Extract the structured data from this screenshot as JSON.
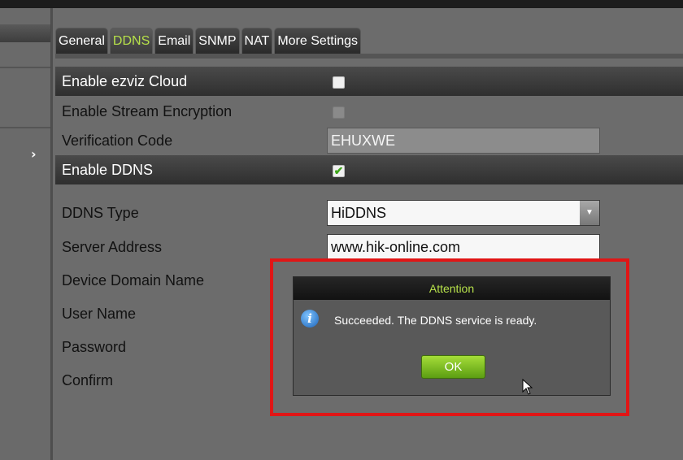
{
  "left_nav": {
    "expand_glyph": "›"
  },
  "tabs": [
    {
      "label": "General"
    },
    {
      "label": "DDNS"
    },
    {
      "label": "Email"
    },
    {
      "label": "SNMP"
    },
    {
      "label": "NAT"
    },
    {
      "label": "More Settings"
    }
  ],
  "active_tab": "DDNS",
  "form": {
    "ezviz_label": "Enable ezviz Cloud",
    "encryption_label": "Enable Stream Encryption",
    "verification_label": "Verification Code",
    "verification_value": "EHUXWE",
    "enable_ddns_label": "Enable DDNS",
    "ddns_type_label": "DDNS Type",
    "ddns_type_value": "HiDDNS",
    "server_address_label": "Server Address",
    "server_address_value": "www.hik-online.com",
    "domain_label": "Device Domain Name",
    "username_label": "User Name",
    "password_label": "Password",
    "confirm_label": "Confirm",
    "enable_ddns_checked": true
  },
  "dialog": {
    "title": "Attention",
    "message": "Succeeded. The DDNS service is ready.",
    "ok_label": "OK"
  },
  "colors": {
    "accent_green": "#b6e04a",
    "highlight_red": "#e01616",
    "panel_gray": "#6c6c6c"
  }
}
